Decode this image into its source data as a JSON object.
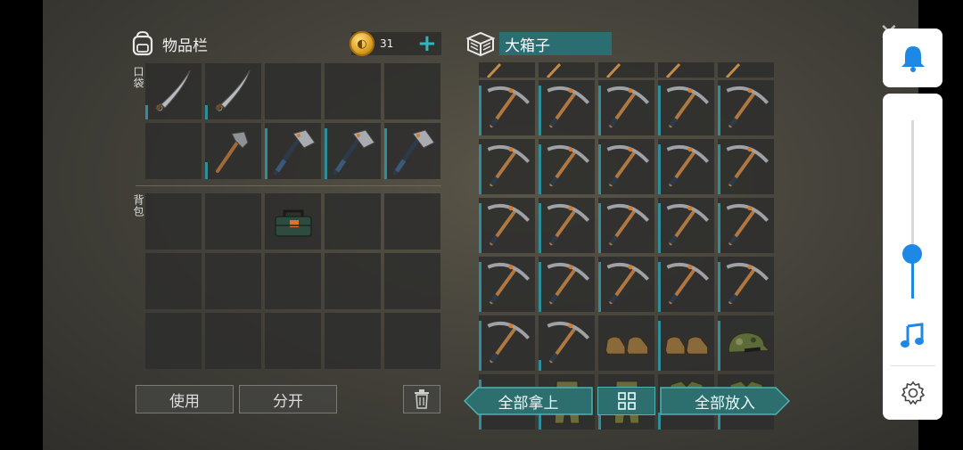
{
  "inventory": {
    "title": "物品栏",
    "coins": "31",
    "pockets_label": "口袋",
    "backpack_label": "背包",
    "pocket_slots": [
      {
        "item": "machete",
        "dur": 0.25
      },
      {
        "item": "machete",
        "dur": 0.25
      },
      {
        "item": "",
        "dur": 0
      },
      {
        "item": "",
        "dur": 0
      },
      {
        "item": "",
        "dur": 0
      },
      {
        "item": "",
        "dur": 0
      },
      {
        "item": "hammer",
        "dur": 0.3
      },
      {
        "item": "axe",
        "dur": 0.9
      },
      {
        "item": "axe",
        "dur": 0.9
      },
      {
        "item": "axe",
        "dur": 0.9
      }
    ],
    "backpack_slots": [
      {
        "item": "",
        "dur": 0
      },
      {
        "item": "",
        "dur": 0
      },
      {
        "item": "toolbox",
        "dur": 0
      },
      {
        "item": "",
        "dur": 0
      },
      {
        "item": "",
        "dur": 0
      },
      {
        "item": "",
        "dur": 0
      },
      {
        "item": "",
        "dur": 0
      },
      {
        "item": "",
        "dur": 0
      },
      {
        "item": "",
        "dur": 0
      },
      {
        "item": "",
        "dur": 0
      },
      {
        "item": "",
        "dur": 0
      },
      {
        "item": "",
        "dur": 0
      },
      {
        "item": "",
        "dur": 0
      },
      {
        "item": "",
        "dur": 0
      },
      {
        "item": "",
        "dur": 0
      }
    ],
    "use_button": "使用",
    "split_button": "分开"
  },
  "crate": {
    "title": "大箱子",
    "slots": [
      {
        "item": "pickaxe",
        "dur": 0.9
      },
      {
        "item": "pickaxe",
        "dur": 0.9
      },
      {
        "item": "pickaxe",
        "dur": 0.9
      },
      {
        "item": "pickaxe",
        "dur": 0.9
      },
      {
        "item": "pickaxe",
        "dur": 0.9
      },
      {
        "item": "pickaxe",
        "dur": 0.9
      },
      {
        "item": "pickaxe",
        "dur": 0.9
      },
      {
        "item": "pickaxe",
        "dur": 0.9
      },
      {
        "item": "pickaxe",
        "dur": 0.9
      },
      {
        "item": "pickaxe",
        "dur": 0.9
      },
      {
        "item": "pickaxe",
        "dur": 0.9
      },
      {
        "item": "pickaxe",
        "dur": 0.9
      },
      {
        "item": "pickaxe",
        "dur": 0.9
      },
      {
        "item": "pickaxe",
        "dur": 0.9
      },
      {
        "item": "pickaxe",
        "dur": 0.9
      },
      {
        "item": "pickaxe",
        "dur": 0.9
      },
      {
        "item": "pickaxe",
        "dur": 0.9
      },
      {
        "item": "pickaxe",
        "dur": 0.9
      },
      {
        "item": "pickaxe",
        "dur": 0.9
      },
      {
        "item": "pickaxe",
        "dur": 0.9
      },
      {
        "item": "pickaxe",
        "dur": 0.9
      },
      {
        "item": "pickaxe",
        "dur": 0.2
      },
      {
        "item": "boots",
        "dur": 0
      },
      {
        "item": "boots",
        "dur": 0.9
      },
      {
        "item": "camo-cap",
        "dur": 0.9
      },
      {
        "item": "camo-cap",
        "dur": 0.9
      },
      {
        "item": "camo-pants",
        "dur": 0.5
      },
      {
        "item": "camo-pants",
        "dur": 0.5
      },
      {
        "item": "camo-vest",
        "dur": 0.3
      },
      {
        "item": "camo-vest",
        "dur": 0.3
      }
    ],
    "take_all_button": "全部拿上",
    "put_all_button": "全部放入"
  },
  "side_panel": {
    "icons": [
      "bell-icon",
      "music-note-icon",
      "gear-icon"
    ],
    "volume_level": 0.25
  },
  "colors": {
    "accent": "#2fb7c0",
    "teal_button": "#2d6f6f",
    "side_blue": "#1e88e5"
  }
}
